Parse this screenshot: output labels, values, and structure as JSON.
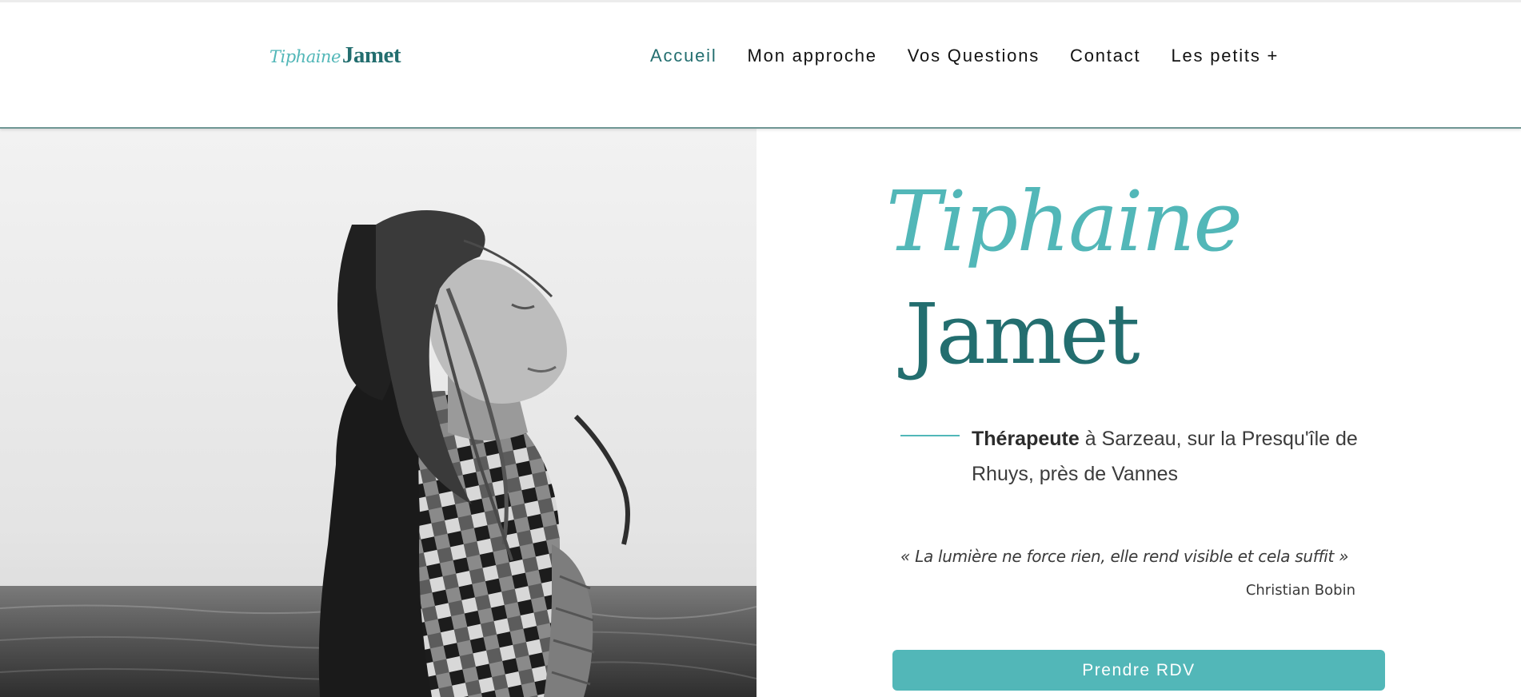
{
  "brand": {
    "logo_first": "Tiphaine",
    "logo_last": "Jamet",
    "accent_color": "#52b7b8",
    "dark_teal": "#236e6f"
  },
  "nav": {
    "items": [
      {
        "label": "Accueil",
        "active": true
      },
      {
        "label": "Mon approche",
        "active": false
      },
      {
        "label": "Vos Questions",
        "active": false
      },
      {
        "label": "Contact",
        "active": false
      },
      {
        "label": "Les petits +",
        "active": false
      }
    ]
  },
  "hero": {
    "photo_icon": "portrait-photo",
    "name_first": "Tiphaine",
    "name_last": "Jamet",
    "subtitle_bold": "Thérapeute",
    "subtitle_rest": " à Sarzeau, sur la Presqu'île de Rhuys, près de Vannes",
    "quote": "« La lumière ne force rien, elle rend visible et cela suffit »",
    "quote_author": "Christian Bobin",
    "cta_label": "Prendre RDV"
  }
}
